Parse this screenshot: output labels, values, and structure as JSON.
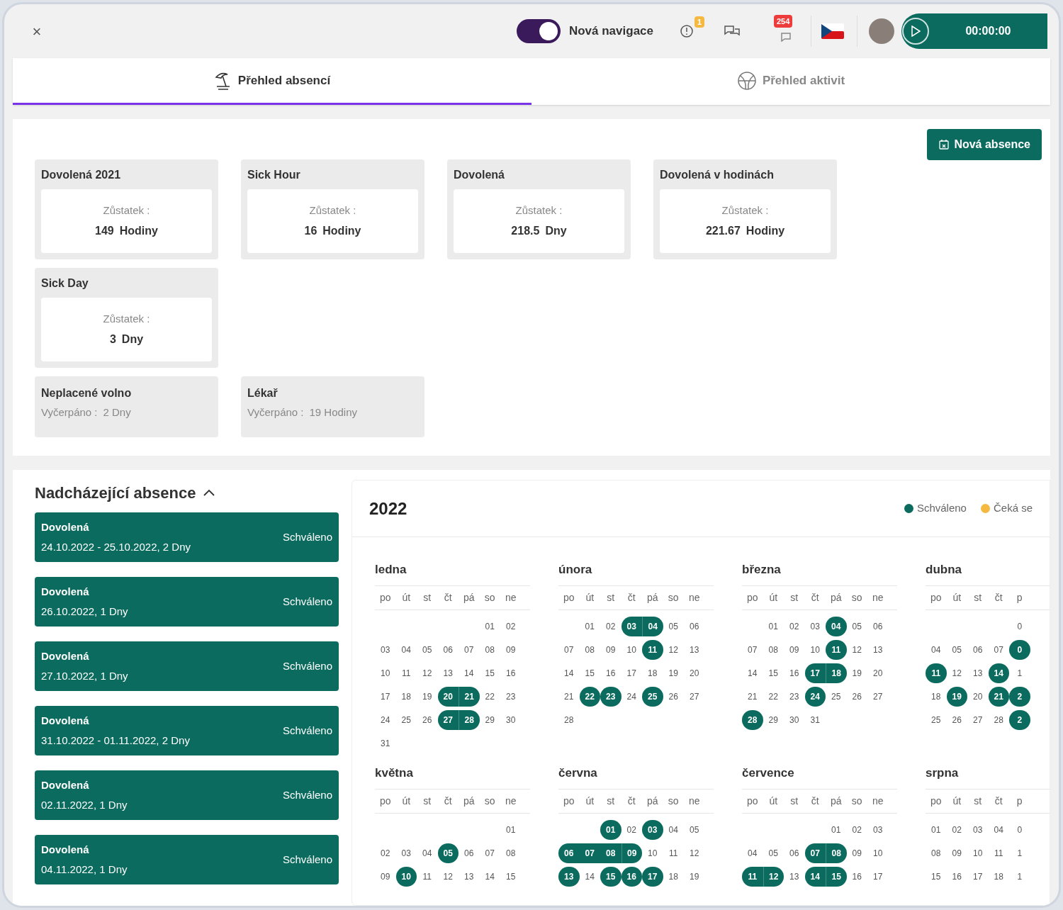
{
  "topbar": {
    "close": "×",
    "toggle": {
      "label": "Nová navigace",
      "on": true
    },
    "alert_badge": "1",
    "message_badge": "254",
    "timer": "00:00:00"
  },
  "tabs": [
    {
      "label": "Přehled absencí",
      "selected": true,
      "kind": "absence"
    },
    {
      "label": "Přehled aktivit",
      "selected": false,
      "kind": "activity"
    }
  ],
  "new_absence_button": "Nová absence",
  "card_rows": [
    [
      {
        "kind": "balance",
        "title": "Dovolená 2021",
        "label": "Zůstatek :",
        "value": "149",
        "unit": "Hodiny"
      },
      {
        "kind": "balance",
        "title": "Sick Hour",
        "label": "Zůstatek :",
        "value": "16",
        "unit": "Hodiny"
      },
      {
        "kind": "balance",
        "title": "Dovolená",
        "label": "Zůstatek :",
        "value": "218.5",
        "unit": "Dny"
      },
      {
        "kind": "balance",
        "title": "Dovolená v hodinách",
        "label": "Zůstatek :",
        "value": "221.67",
        "unit": "Hodiny"
      }
    ],
    [
      {
        "kind": "balance",
        "title": "Sick Day",
        "label": "Zůstatek :",
        "value": "3",
        "unit": "Dny"
      }
    ],
    [
      {
        "kind": "used",
        "title": "Neplacené volno",
        "label": "Vyčerpáno :",
        "value": "2 Dny"
      },
      {
        "kind": "used",
        "title": "Lékař",
        "label": "Vyčerpáno :",
        "value": "19 Hodiny"
      }
    ]
  ],
  "upcoming": {
    "title": "Nadcházející absence",
    "expanded": true,
    "items": [
      {
        "type": "Dovolená",
        "dates": "24.10.2022 - 25.10.2022, 2 Dny",
        "status": "Schváleno"
      },
      {
        "type": "Dovolená",
        "dates": "26.10.2022, 1 Dny",
        "status": "Schváleno"
      },
      {
        "type": "Dovolená",
        "dates": "27.10.2022, 1 Dny",
        "status": "Schváleno"
      },
      {
        "type": "Dovolená",
        "dates": "31.10.2022 - 01.11.2022, 2 Dny",
        "status": "Schváleno"
      },
      {
        "type": "Dovolená",
        "dates": "02.11.2022, 1 Dny",
        "status": "Schváleno"
      },
      {
        "type": "Dovolená",
        "dates": "04.11.2022, 1 Dny",
        "status": "Schváleno"
      }
    ]
  },
  "calendar": {
    "year": "2022",
    "legend": [
      {
        "label": "Schváleno",
        "color": "#0a6b5e"
      },
      {
        "label": "Čeká se",
        "color": "#f5b942"
      }
    ],
    "month_rows": [
      [
        {
          "name": "ledna",
          "weekdays": [
            "po",
            "út",
            "st",
            "čt",
            "pá",
            "so",
            "ne"
          ],
          "weeks": [
            [
              {
                "kind": "blank"
              },
              {
                "kind": "blank"
              },
              {
                "kind": "blank"
              },
              {
                "kind": "blank"
              },
              {
                "kind": "blank"
              },
              {
                "kind": "day",
                "day": "01"
              },
              {
                "kind": "day",
                "day": "02"
              }
            ],
            [
              {
                "kind": "day",
                "day": "03"
              },
              {
                "kind": "day",
                "day": "04"
              },
              {
                "kind": "day",
                "day": "05"
              },
              {
                "kind": "day",
                "day": "06"
              },
              {
                "kind": "day",
                "day": "07"
              },
              {
                "kind": "day",
                "day": "08"
              },
              {
                "kind": "day",
                "day": "09"
              }
            ],
            [
              {
                "kind": "day",
                "day": "10"
              },
              {
                "kind": "day",
                "day": "11"
              },
              {
                "kind": "day",
                "day": "12"
              },
              {
                "kind": "day",
                "day": "13"
              },
              {
                "kind": "day",
                "day": "14"
              },
              {
                "kind": "day",
                "day": "15"
              },
              {
                "kind": "day",
                "day": "16"
              }
            ],
            [
              {
                "kind": "day",
                "day": "17"
              },
              {
                "kind": "day",
                "day": "18"
              },
              {
                "kind": "day",
                "day": "19"
              },
              {
                "kind": "start",
                "day": "20"
              },
              {
                "kind": "end",
                "day": "21"
              },
              {
                "kind": "day",
                "day": "22"
              },
              {
                "kind": "day",
                "day": "23"
              }
            ],
            [
              {
                "kind": "day",
                "day": "24"
              },
              {
                "kind": "day",
                "day": "25"
              },
              {
                "kind": "day",
                "day": "26"
              },
              {
                "kind": "start",
                "day": "27"
              },
              {
                "kind": "end",
                "day": "28"
              },
              {
                "kind": "day",
                "day": "29"
              },
              {
                "kind": "day",
                "day": "30"
              }
            ],
            [
              {
                "kind": "day",
                "day": "31"
              }
            ]
          ]
        },
        {
          "name": "února",
          "weekdays": [
            "po",
            "út",
            "st",
            "čt",
            "pá",
            "so",
            "ne"
          ],
          "weeks": [
            [
              {
                "kind": "blank"
              },
              {
                "kind": "day",
                "day": "01"
              },
              {
                "kind": "day",
                "day": "02"
              },
              {
                "kind": "start",
                "day": "03"
              },
              {
                "kind": "end",
                "day": "04"
              },
              {
                "kind": "day",
                "day": "05"
              },
              {
                "kind": "day",
                "day": "06"
              }
            ],
            [
              {
                "kind": "day",
                "day": "07"
              },
              {
                "kind": "day",
                "day": "08"
              },
              {
                "kind": "day",
                "day": "09"
              },
              {
                "kind": "day",
                "day": "10"
              },
              {
                "kind": "single",
                "day": "11"
              },
              {
                "kind": "day",
                "day": "12"
              },
              {
                "kind": "day",
                "day": "13"
              }
            ],
            [
              {
                "kind": "day",
                "day": "14"
              },
              {
                "kind": "day",
                "day": "15"
              },
              {
                "kind": "day",
                "day": "16"
              },
              {
                "kind": "day",
                "day": "17"
              },
              {
                "kind": "day",
                "day": "18"
              },
              {
                "kind": "day",
                "day": "19"
              },
              {
                "kind": "day",
                "day": "20"
              }
            ],
            [
              {
                "kind": "day",
                "day": "21"
              },
              {
                "kind": "single",
                "day": "22"
              },
              {
                "kind": "single",
                "day": "23"
              },
              {
                "kind": "day",
                "day": "24"
              },
              {
                "kind": "single",
                "day": "25"
              },
              {
                "kind": "day",
                "day": "26"
              },
              {
                "kind": "day",
                "day": "27"
              }
            ],
            [
              {
                "kind": "day",
                "day": "28"
              }
            ]
          ]
        },
        {
          "name": "března",
          "weekdays": [
            "po",
            "út",
            "st",
            "čt",
            "pá",
            "so",
            "ne"
          ],
          "weeks": [
            [
              {
                "kind": "blank"
              },
              {
                "kind": "day",
                "day": "01"
              },
              {
                "kind": "day",
                "day": "02"
              },
              {
                "kind": "day",
                "day": "03"
              },
              {
                "kind": "single",
                "day": "04"
              },
              {
                "kind": "day",
                "day": "05"
              },
              {
                "kind": "day",
                "day": "06"
              }
            ],
            [
              {
                "kind": "day",
                "day": "07"
              },
              {
                "kind": "day",
                "day": "08"
              },
              {
                "kind": "day",
                "day": "09"
              },
              {
                "kind": "day",
                "day": "10"
              },
              {
                "kind": "single",
                "day": "11"
              },
              {
                "kind": "day",
                "day": "12"
              },
              {
                "kind": "day",
                "day": "13"
              }
            ],
            [
              {
                "kind": "day",
                "day": "14"
              },
              {
                "kind": "day",
                "day": "15"
              },
              {
                "kind": "day",
                "day": "16"
              },
              {
                "kind": "start",
                "day": "17"
              },
              {
                "kind": "end",
                "day": "18"
              },
              {
                "kind": "day",
                "day": "19"
              },
              {
                "kind": "day",
                "day": "20"
              }
            ],
            [
              {
                "kind": "day",
                "day": "21"
              },
              {
                "kind": "day",
                "day": "22"
              },
              {
                "kind": "day",
                "day": "23"
              },
              {
                "kind": "single",
                "day": "24"
              },
              {
                "kind": "day",
                "day": "25"
              },
              {
                "kind": "day",
                "day": "26"
              },
              {
                "kind": "day",
                "day": "27"
              }
            ],
            [
              {
                "kind": "single",
                "day": "28"
              },
              {
                "kind": "day",
                "day": "29"
              },
              {
                "kind": "day",
                "day": "30"
              },
              {
                "kind": "day",
                "day": "31"
              }
            ]
          ]
        },
        {
          "name": "dubna",
          "weekdays": [
            "po",
            "út",
            "st",
            "čt",
            "p"
          ],
          "weeks": [
            [
              {
                "kind": "blank"
              },
              {
                "kind": "blank"
              },
              {
                "kind": "blank"
              },
              {
                "kind": "blank"
              },
              {
                "kind": "day",
                "day": "0"
              }
            ],
            [
              {
                "kind": "day",
                "day": "04"
              },
              {
                "kind": "day",
                "day": "05"
              },
              {
                "kind": "day",
                "day": "06"
              },
              {
                "kind": "day",
                "day": "07"
              },
              {
                "kind": "single",
                "day": "0"
              }
            ],
            [
              {
                "kind": "single",
                "day": "11"
              },
              {
                "kind": "day",
                "day": "12"
              },
              {
                "kind": "day",
                "day": "13"
              },
              {
                "kind": "single",
                "day": "14"
              },
              {
                "kind": "day",
                "day": "1"
              }
            ],
            [
              {
                "kind": "day",
                "day": "18"
              },
              {
                "kind": "single",
                "day": "19"
              },
              {
                "kind": "day",
                "day": "20"
              },
              {
                "kind": "single",
                "day": "21"
              },
              {
                "kind": "single",
                "day": "2"
              }
            ],
            [
              {
                "kind": "day",
                "day": "25"
              },
              {
                "kind": "day",
                "day": "26"
              },
              {
                "kind": "day",
                "day": "27"
              },
              {
                "kind": "day",
                "day": "28"
              },
              {
                "kind": "single",
                "day": "2"
              }
            ]
          ]
        }
      ],
      [
        {
          "name": "května",
          "weekdays": [
            "po",
            "út",
            "st",
            "čt",
            "pá",
            "so",
            "ne"
          ],
          "weeks": [
            [
              {
                "kind": "blank"
              },
              {
                "kind": "blank"
              },
              {
                "kind": "blank"
              },
              {
                "kind": "blank"
              },
              {
                "kind": "blank"
              },
              {
                "kind": "blank"
              },
              {
                "kind": "day",
                "day": "01"
              }
            ],
            [
              {
                "kind": "day",
                "day": "02"
              },
              {
                "kind": "day",
                "day": "03"
              },
              {
                "kind": "day",
                "day": "04"
              },
              {
                "kind": "single",
                "day": "05"
              },
              {
                "kind": "day",
                "day": "06"
              },
              {
                "kind": "day",
                "day": "07"
              },
              {
                "kind": "day",
                "day": "08"
              }
            ],
            [
              {
                "kind": "day",
                "day": "09"
              },
              {
                "kind": "single",
                "day": "10"
              },
              {
                "kind": "day",
                "day": "11"
              },
              {
                "kind": "day",
                "day": "12"
              },
              {
                "kind": "day",
                "day": "13"
              },
              {
                "kind": "day",
                "day": "14"
              },
              {
                "kind": "day",
                "day": "15"
              }
            ]
          ]
        },
        {
          "name": "června",
          "weekdays": [
            "po",
            "út",
            "st",
            "čt",
            "pá",
            "so",
            "ne"
          ],
          "weeks": [
            [
              {
                "kind": "blank"
              },
              {
                "kind": "blank"
              },
              {
                "kind": "single",
                "day": "01"
              },
              {
                "kind": "day",
                "day": "02"
              },
              {
                "kind": "single",
                "day": "03"
              },
              {
                "kind": "day",
                "day": "04"
              },
              {
                "kind": "day",
                "day": "05"
              }
            ],
            [
              {
                "kind": "start",
                "day": "06"
              },
              {
                "kind": "middle",
                "day": "07"
              },
              {
                "kind": "middle",
                "day": "08"
              },
              {
                "kind": "end",
                "day": "09"
              },
              {
                "kind": "day",
                "day": "10"
              },
              {
                "kind": "day",
                "day": "11"
              },
              {
                "kind": "day",
                "day": "12"
              }
            ],
            [
              {
                "kind": "single",
                "day": "13"
              },
              {
                "kind": "day",
                "day": "14"
              },
              {
                "kind": "single",
                "day": "15"
              },
              {
                "kind": "single",
                "day": "16"
              },
              {
                "kind": "single",
                "day": "17"
              },
              {
                "kind": "day",
                "day": "18"
              },
              {
                "kind": "day",
                "day": "19"
              }
            ]
          ]
        },
        {
          "name": "července",
          "weekdays": [
            "po",
            "út",
            "st",
            "čt",
            "pá",
            "so",
            "ne"
          ],
          "weeks": [
            [
              {
                "kind": "blank"
              },
              {
                "kind": "blank"
              },
              {
                "kind": "blank"
              },
              {
                "kind": "blank"
              },
              {
                "kind": "day",
                "day": "01"
              },
              {
                "kind": "day",
                "day": "02"
              },
              {
                "kind": "day",
                "day": "03"
              }
            ],
            [
              {
                "kind": "day",
                "day": "04"
              },
              {
                "kind": "day",
                "day": "05"
              },
              {
                "kind": "day",
                "day": "06"
              },
              {
                "kind": "start",
                "day": "07"
              },
              {
                "kind": "end",
                "day": "08"
              },
              {
                "kind": "day",
                "day": "09"
              },
              {
                "kind": "day",
                "day": "10"
              }
            ],
            [
              {
                "kind": "start",
                "day": "11"
              },
              {
                "kind": "end",
                "day": "12"
              },
              {
                "kind": "day",
                "day": "13"
              },
              {
                "kind": "start",
                "day": "14"
              },
              {
                "kind": "end",
                "day": "15"
              },
              {
                "kind": "day",
                "day": "16"
              },
              {
                "kind": "day",
                "day": "17"
              }
            ]
          ]
        },
        {
          "name": "srpna",
          "weekdays": [
            "po",
            "út",
            "st",
            "čt",
            "p"
          ],
          "weeks": [
            [
              {
                "kind": "day",
                "day": "01"
              },
              {
                "kind": "day",
                "day": "02"
              },
              {
                "kind": "day",
                "day": "03"
              },
              {
                "kind": "day",
                "day": "04"
              },
              {
                "kind": "day",
                "day": "0"
              }
            ],
            [
              {
                "kind": "day",
                "day": "08"
              },
              {
                "kind": "day",
                "day": "09"
              },
              {
                "kind": "day",
                "day": "10"
              },
              {
                "kind": "day",
                "day": "11"
              },
              {
                "kind": "day",
                "day": "1"
              }
            ],
            [
              {
                "kind": "day",
                "day": "15"
              },
              {
                "kind": "day",
                "day": "16"
              },
              {
                "kind": "day",
                "day": "17"
              },
              {
                "kind": "day",
                "day": "18"
              },
              {
                "kind": "day",
                "day": "1"
              }
            ]
          ]
        }
      ]
    ]
  }
}
